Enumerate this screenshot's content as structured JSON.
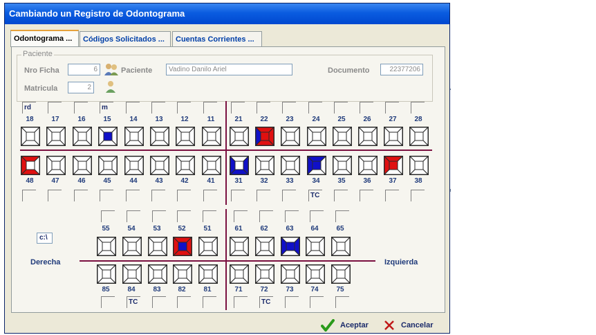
{
  "window": {
    "title": "Cambiando un Registro de Odontograma"
  },
  "tabs": [
    {
      "label": "Odontograma ...",
      "active": true
    },
    {
      "label": "Códigos Solicitados ...",
      "active": false
    },
    {
      "label": "Cuentas Corrientes ...",
      "active": false
    }
  ],
  "paciente": {
    "legend": "Paciente",
    "nro_ficha_label": "Nro Ficha",
    "nro_ficha": "6",
    "paciente_label": "Paciente",
    "nombre": "Vadino Danilo Ariel",
    "documento_label": "Documento",
    "documento": "22377206",
    "matricula_label": "Matricula",
    "matricula": "2"
  },
  "labels": {
    "derecha": "Derecha",
    "izquierda": "Izquierda",
    "box": "c:\\"
  },
  "permanent": {
    "upper": [
      {
        "n": "18",
        "code": "rd"
      },
      {
        "n": "17",
        "code": ""
      },
      {
        "n": "16",
        "code": ""
      },
      {
        "n": "15",
        "code": "m"
      },
      {
        "n": "14",
        "code": ""
      },
      {
        "n": "13",
        "code": ""
      },
      {
        "n": "12",
        "code": ""
      },
      {
        "n": "11",
        "code": ""
      },
      {
        "n": "21",
        "code": ""
      },
      {
        "n": "22",
        "code": ""
      },
      {
        "n": "23",
        "code": ""
      },
      {
        "n": "24",
        "code": ""
      },
      {
        "n": "25",
        "code": ""
      },
      {
        "n": "26",
        "code": ""
      },
      {
        "n": "27",
        "code": ""
      },
      {
        "n": "28",
        "code": ""
      }
    ],
    "lower": [
      {
        "n": "48",
        "code": ""
      },
      {
        "n": "47",
        "code": ""
      },
      {
        "n": "46",
        "code": ""
      },
      {
        "n": "45",
        "code": ""
      },
      {
        "n": "44",
        "code": ""
      },
      {
        "n": "43",
        "code": ""
      },
      {
        "n": "42",
        "code": ""
      },
      {
        "n": "41",
        "code": ""
      },
      {
        "n": "31",
        "code": ""
      },
      {
        "n": "32",
        "code": ""
      },
      {
        "n": "33",
        "code": ""
      },
      {
        "n": "34",
        "code": "TC"
      },
      {
        "n": "35",
        "code": ""
      },
      {
        "n": "36",
        "code": ""
      },
      {
        "n": "37",
        "code": ""
      },
      {
        "n": "38",
        "code": ""
      }
    ]
  },
  "deciduous": {
    "upper": [
      {
        "n": "55",
        "code": ""
      },
      {
        "n": "54",
        "code": ""
      },
      {
        "n": "53",
        "code": ""
      },
      {
        "n": "52",
        "code": ""
      },
      {
        "n": "51",
        "code": ""
      },
      {
        "n": "61",
        "code": ""
      },
      {
        "n": "62",
        "code": ""
      },
      {
        "n": "63",
        "code": ""
      },
      {
        "n": "64",
        "code": ""
      },
      {
        "n": "65",
        "code": ""
      }
    ],
    "lower": [
      {
        "n": "85",
        "code": ""
      },
      {
        "n": "84",
        "code": "TC"
      },
      {
        "n": "83",
        "code": ""
      },
      {
        "n": "82",
        "code": ""
      },
      {
        "n": "81",
        "code": ""
      },
      {
        "n": "71",
        "code": ""
      },
      {
        "n": "72",
        "code": "TC"
      },
      {
        "n": "73",
        "code": ""
      },
      {
        "n": "74",
        "code": ""
      },
      {
        "n": "75",
        "code": ""
      }
    ]
  },
  "markings": {
    "15": {
      "center": "blue"
    },
    "22": {
      "top": "red",
      "right": "red",
      "bottom": "red",
      "left": "blue",
      "center": "red"
    },
    "48": {
      "top": "red",
      "left": "red",
      "bottom": "red"
    },
    "31": {
      "left": "blue",
      "right": "blue",
      "bottom": "blue"
    },
    "34": {
      "top": "blue",
      "left": "blue",
      "center": "blue"
    },
    "37": {
      "top": "red",
      "left": "red",
      "center": "red"
    },
    "52": {
      "top": "red",
      "left": "red",
      "bottom": "red",
      "right": "red",
      "center": "blue"
    },
    "63": {
      "left": "blue",
      "right": "blue",
      "center": "blue"
    }
  },
  "colors": {
    "red": "#e01010",
    "blue": "#1010c8",
    "midline": "#7a1040"
  },
  "buttons": {
    "aceptar": "Aceptar",
    "cancelar": "Cancelar"
  }
}
